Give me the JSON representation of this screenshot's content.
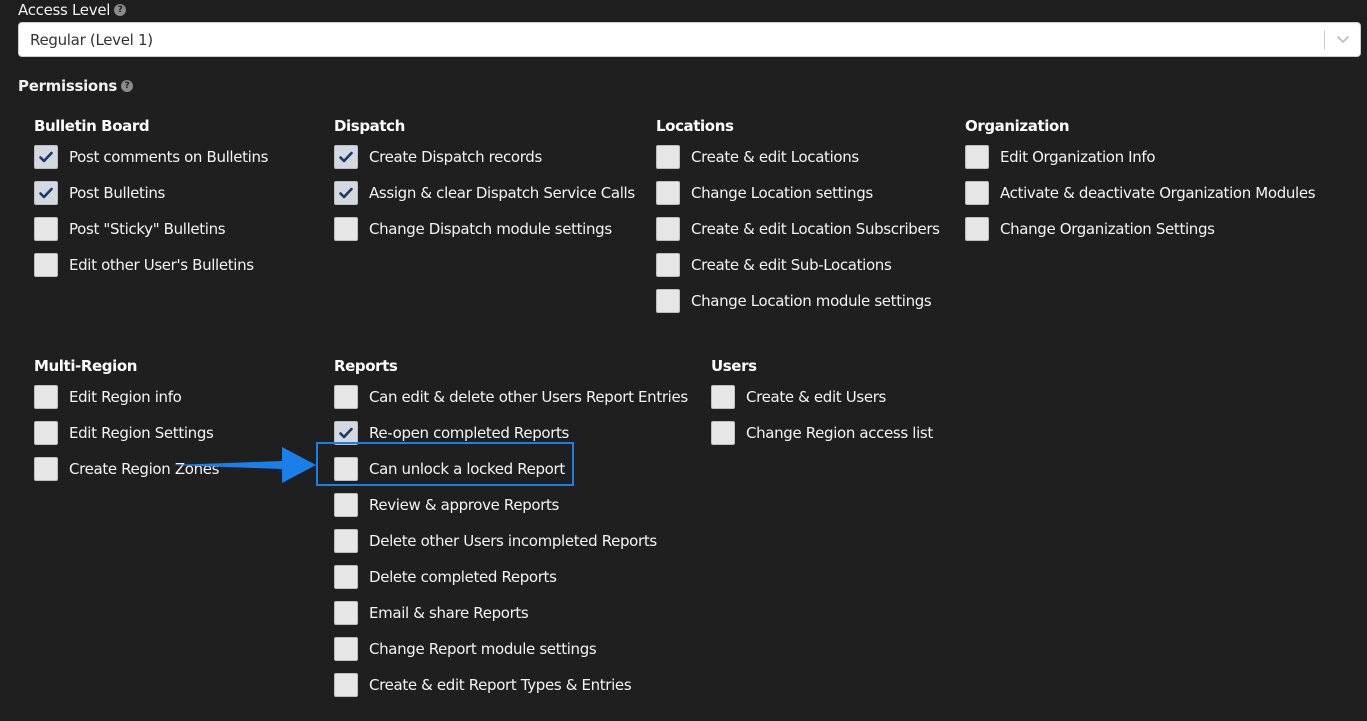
{
  "access_level": {
    "label": "Access Level",
    "help_icon": "question-circle-icon",
    "selected": "Regular (Level 1)",
    "dropdown_icon": "chevron-down-icon"
  },
  "permissions": {
    "label": "Permissions",
    "help_icon": "question-circle-icon",
    "groups": [
      {
        "title": "Bulletin Board",
        "items": [
          {
            "label": "Post comments on Bulletins",
            "checked": true
          },
          {
            "label": "Post Bulletins",
            "checked": true
          },
          {
            "label": "Post \"Sticky\" Bulletins",
            "checked": false
          },
          {
            "label": "Edit other User's Bulletins",
            "checked": false
          }
        ]
      },
      {
        "title": "Dispatch",
        "items": [
          {
            "label": "Create Dispatch records",
            "checked": true
          },
          {
            "label": "Assign & clear Dispatch Service Calls",
            "checked": true
          },
          {
            "label": "Change Dispatch module settings",
            "checked": false
          }
        ]
      },
      {
        "title": "Locations",
        "items": [
          {
            "label": "Create & edit Locations",
            "checked": false
          },
          {
            "label": "Change Location settings",
            "checked": false
          },
          {
            "label": "Create & edit Location Subscribers",
            "checked": false
          },
          {
            "label": "Create & edit Sub-Locations",
            "checked": false
          },
          {
            "label": "Change Location module settings",
            "checked": false
          }
        ]
      },
      {
        "title": "Organization",
        "items": [
          {
            "label": "Edit Organization Info",
            "checked": false
          },
          {
            "label": "Activate & deactivate Organization Modules",
            "checked": false
          },
          {
            "label": "Change Organization Settings",
            "checked": false
          }
        ]
      },
      {
        "title": "Multi-Region",
        "items": [
          {
            "label": "Edit Region info",
            "checked": false
          },
          {
            "label": "Edit Region Settings",
            "checked": false
          },
          {
            "label": "Create Region Zones",
            "checked": false
          }
        ]
      },
      {
        "title": "Reports",
        "items": [
          {
            "label": "Can edit & delete other Users Report Entries",
            "checked": false
          },
          {
            "label": "Re-open completed Reports",
            "checked": true
          },
          {
            "label": "Can unlock a locked Report",
            "checked": false
          },
          {
            "label": "Review & approve Reports",
            "checked": false
          },
          {
            "label": "Delete other Users incompleted Reports",
            "checked": false
          },
          {
            "label": "Delete completed Reports",
            "checked": false
          },
          {
            "label": "Email & share Reports",
            "checked": false
          },
          {
            "label": "Change Report module settings",
            "checked": false
          },
          {
            "label": "Create & edit Report Types & Entries",
            "checked": false
          }
        ]
      },
      {
        "title": "Users",
        "items": [
          {
            "label": "Create & edit Users",
            "checked": false
          },
          {
            "label": "Change Region access list",
            "checked": false
          }
        ]
      }
    ]
  },
  "annotation": {
    "highlighted_item": "Can unlock a locked Report",
    "highlight_color": "#1a7fe8",
    "arrow_icon": "arrow-right-icon"
  },
  "colors": {
    "background": "#1f1f1f",
    "checkmark": "#1a3a6b",
    "checkbox_fill": "#e6e6e6"
  }
}
